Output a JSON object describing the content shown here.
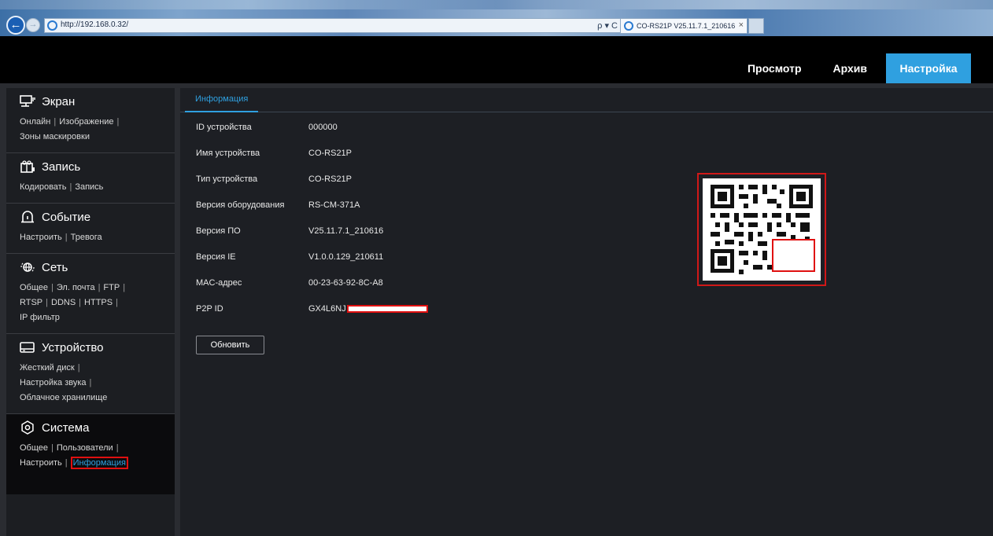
{
  "browser": {
    "back_icon": "back-arrow-icon",
    "forward_icon": "forward-arrow-icon",
    "url": "http://192.168.0.32/",
    "url_tools": "ρ ▾ C",
    "tab_title": "CO-RS21P V25.11.7.1_210616",
    "tab_close": "×"
  },
  "top_nav": {
    "items": [
      "Просмотр",
      "Архив",
      "Настройка"
    ],
    "active_index": 2
  },
  "sidebar": {
    "sections": [
      {
        "title": "Экран",
        "icon": "monitor-icon",
        "links": [
          "Онлайн",
          "Изображение",
          "Зоны маскировки"
        ]
      },
      {
        "title": "Запись",
        "icon": "record-icon",
        "links": [
          "Кодировать",
          "Запись"
        ]
      },
      {
        "title": "Событие",
        "icon": "alarm-icon",
        "links": [
          "Настроить",
          "Тревога"
        ]
      },
      {
        "title": "Сеть",
        "icon": "network-icon",
        "links": [
          "Общее",
          "Эл. почта",
          "FTP",
          "RTSP",
          "DDNS",
          "HTTPS",
          "IP фильтр"
        ]
      },
      {
        "title": "Устройство",
        "icon": "hdd-icon",
        "links": [
          "Жесткий диск",
          "Настройка звука",
          "Облачное хранилище"
        ]
      },
      {
        "title": "Система",
        "icon": "gear-icon",
        "links": [
          "Общее",
          "Пользователи",
          "Настроить",
          "Информация"
        ]
      }
    ]
  },
  "main": {
    "tab": "Информация",
    "info": [
      {
        "label": "ID устройства",
        "value": "000000"
      },
      {
        "label": "Имя устройства",
        "value": "CO-RS21P"
      },
      {
        "label": "Тип устройства",
        "value": "CO-RS21P"
      },
      {
        "label": "Версия оборудования",
        "value": "RS-CM-371A"
      },
      {
        "label": "Версия ПО",
        "value": "V25.11.7.1_210616"
      },
      {
        "label": "Версия IE",
        "value": "V1.0.0.129_210611"
      },
      {
        "label": "MAC-адрес",
        "value": "00-23-63-92-8C-A8"
      },
      {
        "label": "P2P ID",
        "value": "GX4L6NJ"
      }
    ],
    "refresh_label": "Обновить"
  },
  "colors": {
    "accent": "#2fa0e0",
    "highlight_red": "#e01010",
    "background": "#1d1f24"
  }
}
